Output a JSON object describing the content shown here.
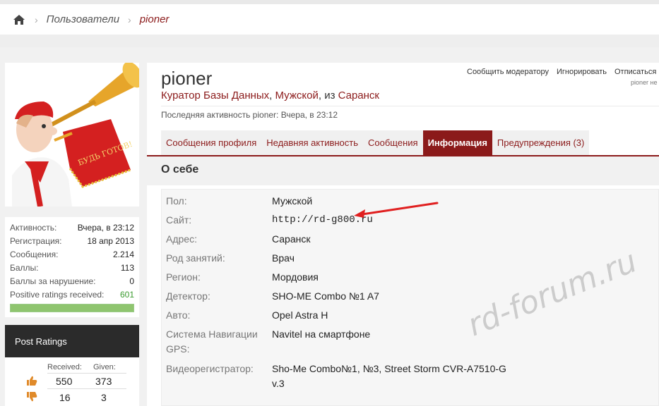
{
  "breadcrumb": {
    "items": [
      "Пользователи",
      "pioner"
    ]
  },
  "sidebar": {
    "stats": [
      {
        "label": "Активность:",
        "value": "Вчера, в 23:12"
      },
      {
        "label": "Регистрация:",
        "value": "18 апр 2013"
      },
      {
        "label": "Сообщения:",
        "value": "2.214"
      },
      {
        "label": "Баллы:",
        "value": "113"
      },
      {
        "label": "Баллы за нарушение:",
        "value": "0"
      },
      {
        "label": "Positive ratings received:",
        "value": "601"
      }
    ],
    "positive_ratio": 1.0,
    "ratings": {
      "title": "Post Ratings",
      "received_label": "Received:",
      "given_label": "Given:",
      "rows": [
        {
          "icon": "thumbs-up-icon",
          "received": "550",
          "given": "373"
        },
        {
          "icon": "thumbs-down-icon",
          "received": "16",
          "given": "3"
        }
      ]
    }
  },
  "profile": {
    "username": "pioner",
    "title": "Куратор Базы Данных",
    "gender": "Мужской",
    "location_prefix": "из",
    "location": "Саранск",
    "last_activity_label": "Последняя активность pioner:",
    "last_activity_value": "Вчера, в 23:12",
    "actions": [
      "Сообщить модератору",
      "Игнорировать",
      "Отписаться"
    ],
    "reg_note": "pioner не"
  },
  "tabs": [
    {
      "label": "Сообщения профиля",
      "active": false
    },
    {
      "label": "Недавняя активность",
      "active": false
    },
    {
      "label": "Сообщения",
      "active": false
    },
    {
      "label": "Информация",
      "active": true
    },
    {
      "label": "Предупреждения (3)",
      "active": false
    }
  ],
  "about": {
    "title": "О себе",
    "fields": [
      {
        "label": "Пол:",
        "value": "Мужской"
      },
      {
        "label": "Сайт:",
        "value": "http://rd-g800.ru"
      },
      {
        "label": "Адрес:",
        "value": "Саранск"
      },
      {
        "label": "Род занятий:",
        "value": "Врач"
      },
      {
        "label": "Регион:",
        "value": "Мордовия"
      },
      {
        "label": "Детектор:",
        "value": "SHO-ME Combo №1 A7"
      },
      {
        "label": "Авто:",
        "value": "Opel Astra H"
      },
      {
        "label": "Система Навигации GPS:",
        "value": "Navitel на смартфоне"
      },
      {
        "label": "Видеорегистратор:",
        "value": "Sho-Me Combo№1, №3, Street Storm CVR-A7510-G v.3"
      }
    ]
  },
  "avatar_banner_text": "БУДЬ ГОТОВ!",
  "watermark": "rd-forum.ru",
  "colors": {
    "accent": "#8b1a1a",
    "positive": "#3a9a2e",
    "annotation_arrow": "#e02020"
  }
}
